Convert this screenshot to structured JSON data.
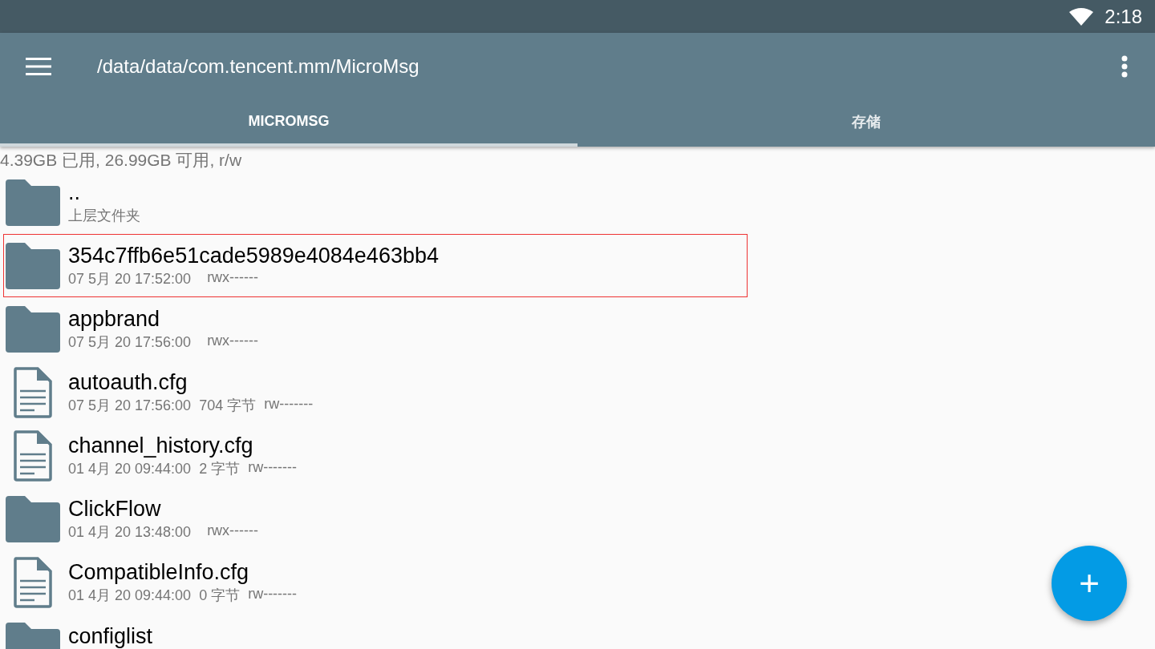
{
  "status_bar": {
    "time": "2:18"
  },
  "toolbar": {
    "path": "/data/data/com.tencent.mm/MicroMsg"
  },
  "tabs": [
    {
      "label": "MICROMSG",
      "selected": true
    },
    {
      "label": "存储",
      "selected": false
    }
  ],
  "storage_info": "4.39GB 已用, 26.99GB 可用, r/w",
  "files": [
    {
      "kind": "folder",
      "name": "..",
      "subtitle": "上层文件夹",
      "highlighted": false
    },
    {
      "kind": "folder",
      "name": "354c7ffb6e51cade5989e4084e463bb4",
      "date": "07 5月 20 17:52:00",
      "permissions": "rwx------",
      "highlighted": true
    },
    {
      "kind": "folder",
      "name": "appbrand",
      "date": "07 5月 20 17:56:00",
      "permissions": "rwx------",
      "highlighted": false
    },
    {
      "kind": "file",
      "name": "autoauth.cfg",
      "date": "07 5月 20 17:56:00",
      "size": "704 字节",
      "permissions": "rw-------",
      "highlighted": false
    },
    {
      "kind": "file",
      "name": "channel_history.cfg",
      "date": "01 4月 20 09:44:00",
      "size": "2 字节",
      "permissions": "rw-------",
      "highlighted": false
    },
    {
      "kind": "folder",
      "name": "ClickFlow",
      "date": "01 4月 20 13:48:00",
      "permissions": "rwx------",
      "highlighted": false
    },
    {
      "kind": "file",
      "name": "CompatibleInfo.cfg",
      "date": "01 4月 20 09:44:00",
      "size": "0 字节",
      "permissions": "rw-------",
      "highlighted": false
    },
    {
      "kind": "folder",
      "name": "configlist",
      "highlighted": false
    }
  ],
  "fab": {
    "symbol": "+"
  }
}
